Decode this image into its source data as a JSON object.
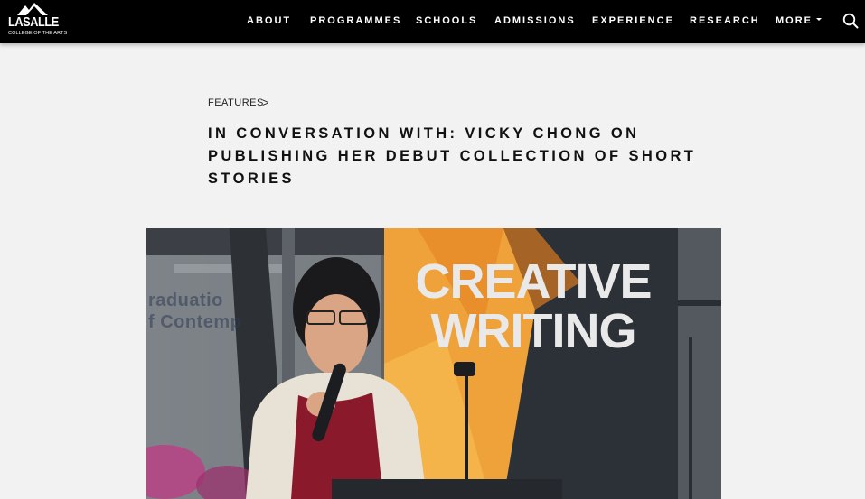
{
  "header": {
    "logo_text": "LASALLE",
    "logo_tagline": "COLLEGE OF THE ARTS",
    "nav": [
      {
        "label": "ABOUT"
      },
      {
        "label": "PROGRAMMES"
      },
      {
        "label": "SCHOOLS"
      },
      {
        "label": "ADMISSIONS"
      },
      {
        "label": "EXPERIENCE"
      },
      {
        "label": "RESEARCH"
      },
      {
        "label": "MORE"
      }
    ],
    "search_icon": "search-icon"
  },
  "article": {
    "breadcrumb": "FEATURES",
    "breadcrumb_sep": ">",
    "title": "IN CONVERSATION WITH: VICKY CHONG ON PUBLISHING HER DEBUT COLLECTION OF SHORT STORIES",
    "hero": {
      "banner_line1": "CREATIVE",
      "banner_line2": "WRITING",
      "bg_sign_line1": "raduatio",
      "bg_sign_line2": "f Contemp"
    }
  },
  "colors": {
    "nav_bg": "#000000",
    "page_bg": "#f2f2f2",
    "banner_orange": "#f0a23a",
    "banner_dark": "#2c3037"
  }
}
